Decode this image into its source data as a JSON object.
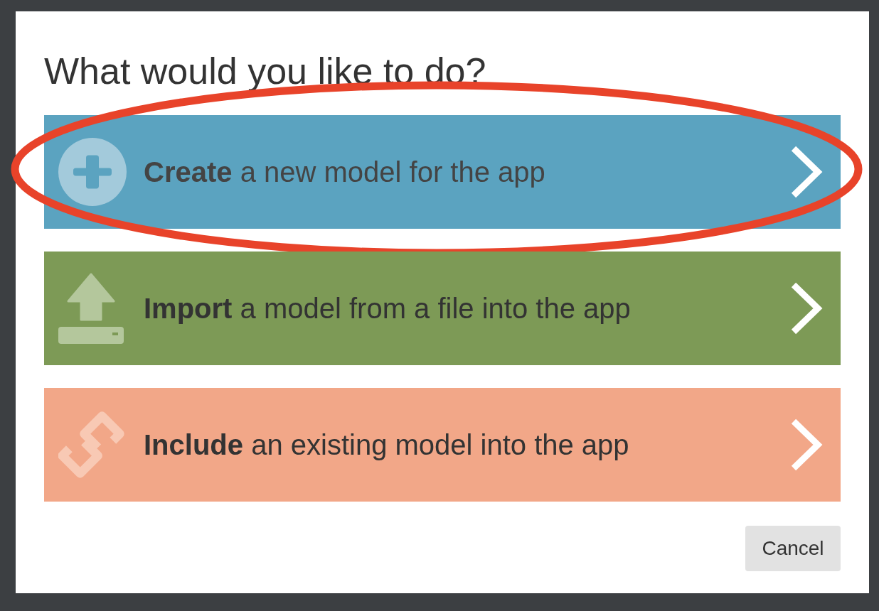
{
  "dialog": {
    "title": "What would you like to do?",
    "options": [
      {
        "kind": "create",
        "label": "**Create** a new model for the app",
        "color": "#5ba3c0",
        "highlighted": true
      },
      {
        "kind": "import",
        "label": "**Import** a model from a file into the app",
        "color": "#7d9a56",
        "highlighted": false
      },
      {
        "kind": "include",
        "label": "**Include** an existing model into the app",
        "color": "#f2a788",
        "highlighted": false
      }
    ],
    "cancel_button": "Cancel"
  }
}
